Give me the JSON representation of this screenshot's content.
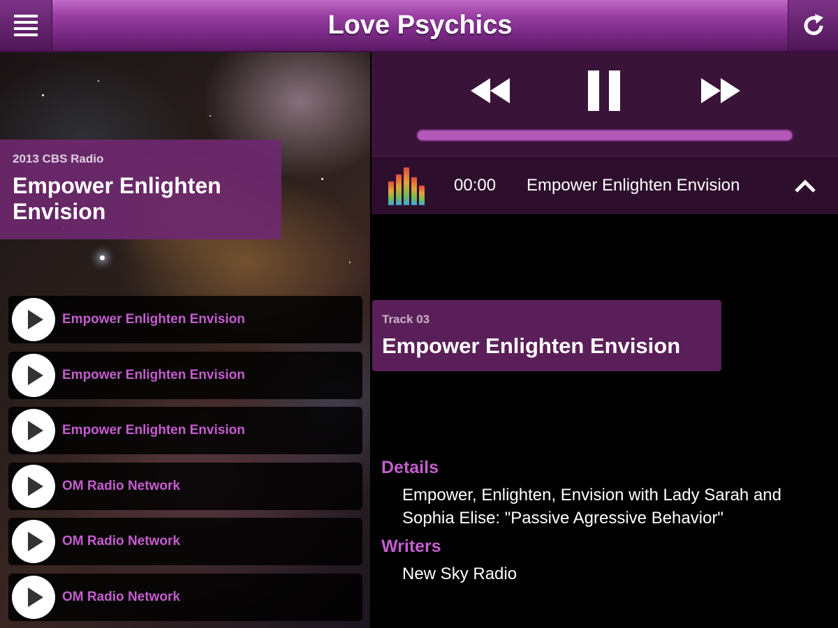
{
  "header": {
    "title": "Love Psychics"
  },
  "album": {
    "subtitle": "2013 CBS Radio",
    "title": "Empower Enlighten Envision"
  },
  "tracks": [
    {
      "label": "Empower Enlighten Envision"
    },
    {
      "label": "Empower Enlighten Envision"
    },
    {
      "label": "Empower Enlighten Envision"
    },
    {
      "label": "OM Radio Network"
    },
    {
      "label": "OM Radio Network"
    },
    {
      "label": "OM Radio Network"
    }
  ],
  "player": {
    "time": "00:00",
    "now_playing": "Empower Enlighten Envision",
    "progress": 1.0
  },
  "current_track": {
    "number": "Track 03",
    "title": "Empower Enlighten Envision"
  },
  "details": {
    "details_heading": "Details",
    "details_text": "Empower, Enlighten, Envision with Lady Sarah and Sophia Elise: \"Passive Agressive Behavior\"",
    "writers_heading": "Writers",
    "writers_text": "New Sky Radio"
  },
  "colors": {
    "accent": "#c55dcf",
    "header": "#9a3fa3",
    "panel": "#3a1338"
  }
}
